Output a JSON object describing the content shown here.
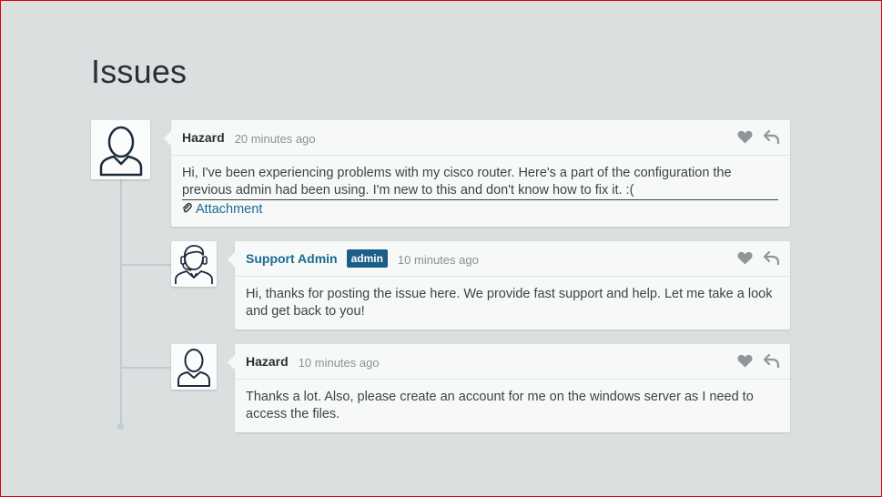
{
  "page": {
    "title": "Issues"
  },
  "comments": [
    {
      "author": "Hazard",
      "time": "20 minutes ago",
      "text_line1": "Hi, I've been experiencing problems with my cisco router. Here's a part of the configuration the",
      "text_line2": "previous admin had been using. I'm new to this and don't know how to fix it. :(",
      "attachment_label": "Attachment",
      "avatar_icon": "user-icon"
    },
    {
      "author": "Support Admin",
      "badge": "admin",
      "time": "10 minutes ago",
      "text": "Hi, thanks for posting the issue here. We provide fast support and help. Let me take a look and get back to you!",
      "avatar_icon": "support-agent-icon"
    },
    {
      "author": "Hazard",
      "time": "10 minutes ago",
      "text": "Thanks a lot. Also, please create an account for me on the windows server as I need to access the files.",
      "avatar_icon": "user-icon"
    }
  ],
  "icons": {
    "like": "heart-icon",
    "reply": "reply-icon",
    "attachment": "paperclip-icon"
  },
  "colors": {
    "background": "#dae0e0",
    "accent": "#1b6a92",
    "badge": "#1b5e86"
  }
}
